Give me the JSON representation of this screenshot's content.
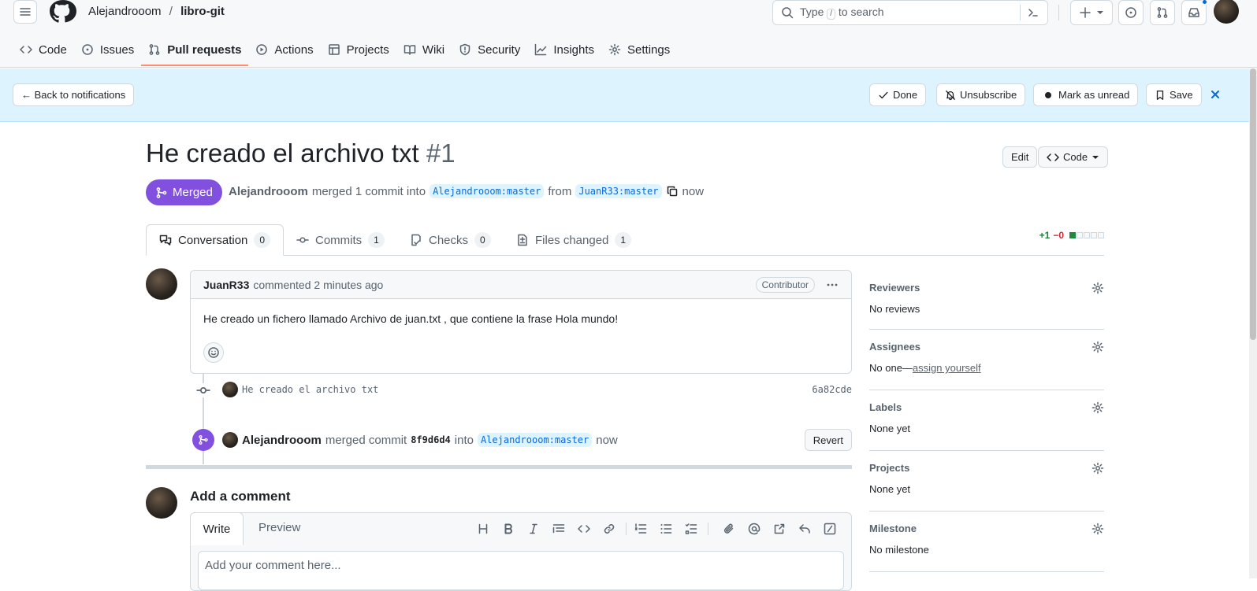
{
  "header": {
    "owner": "Alejandrooom",
    "separator": "/",
    "repo": "libro-git",
    "search_prefix": "Type",
    "search_key": "/",
    "search_suffix": "to search"
  },
  "nav": {
    "code": "Code",
    "issues": "Issues",
    "pulls": "Pull requests",
    "actions": "Actions",
    "projects": "Projects",
    "wiki": "Wiki",
    "security": "Security",
    "insights": "Insights",
    "settings": "Settings"
  },
  "notif": {
    "back": "← Back to notifications",
    "done": "Done",
    "unsubscribe": "Unsubscribe",
    "mark_unread": "Mark as unread",
    "save": "Save"
  },
  "pr": {
    "title": "He creado el archivo txt",
    "number": "#1",
    "edit": "Edit",
    "code": "Code",
    "state": "Merged",
    "author": "Alejandrooom",
    "action": "merged 1 commit into",
    "base": "Alejandrooom:master",
    "from": "from",
    "head": "JuanR33:master",
    "when": "now"
  },
  "tabs": {
    "conversation": "Conversation",
    "conversation_count": "0",
    "commits": "Commits",
    "commits_count": "1",
    "checks": "Checks",
    "checks_count": "0",
    "files": "Files changed",
    "files_count": "1",
    "additions": "+1",
    "deletions": "−0"
  },
  "comment": {
    "author": "JuanR33",
    "meta": "commented 2 minutes ago",
    "role": "Contributor",
    "body": "He creado un fichero llamado Archivo de juan.txt , que contiene la frase Hola mundo!"
  },
  "commit": {
    "message": "He creado el archivo txt",
    "sha": "6a82cde"
  },
  "merge_event": {
    "actor": "Alejandrooom",
    "action": "merged commit",
    "sha": "8f9d6d4",
    "into": "into",
    "branch": "Alejandrooom:master",
    "when": "now",
    "revert": "Revert"
  },
  "add_comment": {
    "title": "Add a comment",
    "write": "Write",
    "preview": "Preview",
    "placeholder": "Add your comment here..."
  },
  "sidebar": {
    "reviewers": "Reviewers",
    "reviewers_value": "No reviews",
    "assignees": "Assignees",
    "assignees_value": "No one—",
    "assign_link": "assign yourself",
    "labels": "Labels",
    "labels_value": "None yet",
    "projects": "Projects",
    "projects_value": "None yet",
    "milestone": "Milestone",
    "milestone_value": "No milestone"
  },
  "colors": {
    "merged": "#8250df",
    "accent": "#0969da",
    "tab_underline": "#fd8c73",
    "notif_bg": "#ddf4ff",
    "additions": "#1a7f37",
    "deletions": "#d1242f"
  }
}
